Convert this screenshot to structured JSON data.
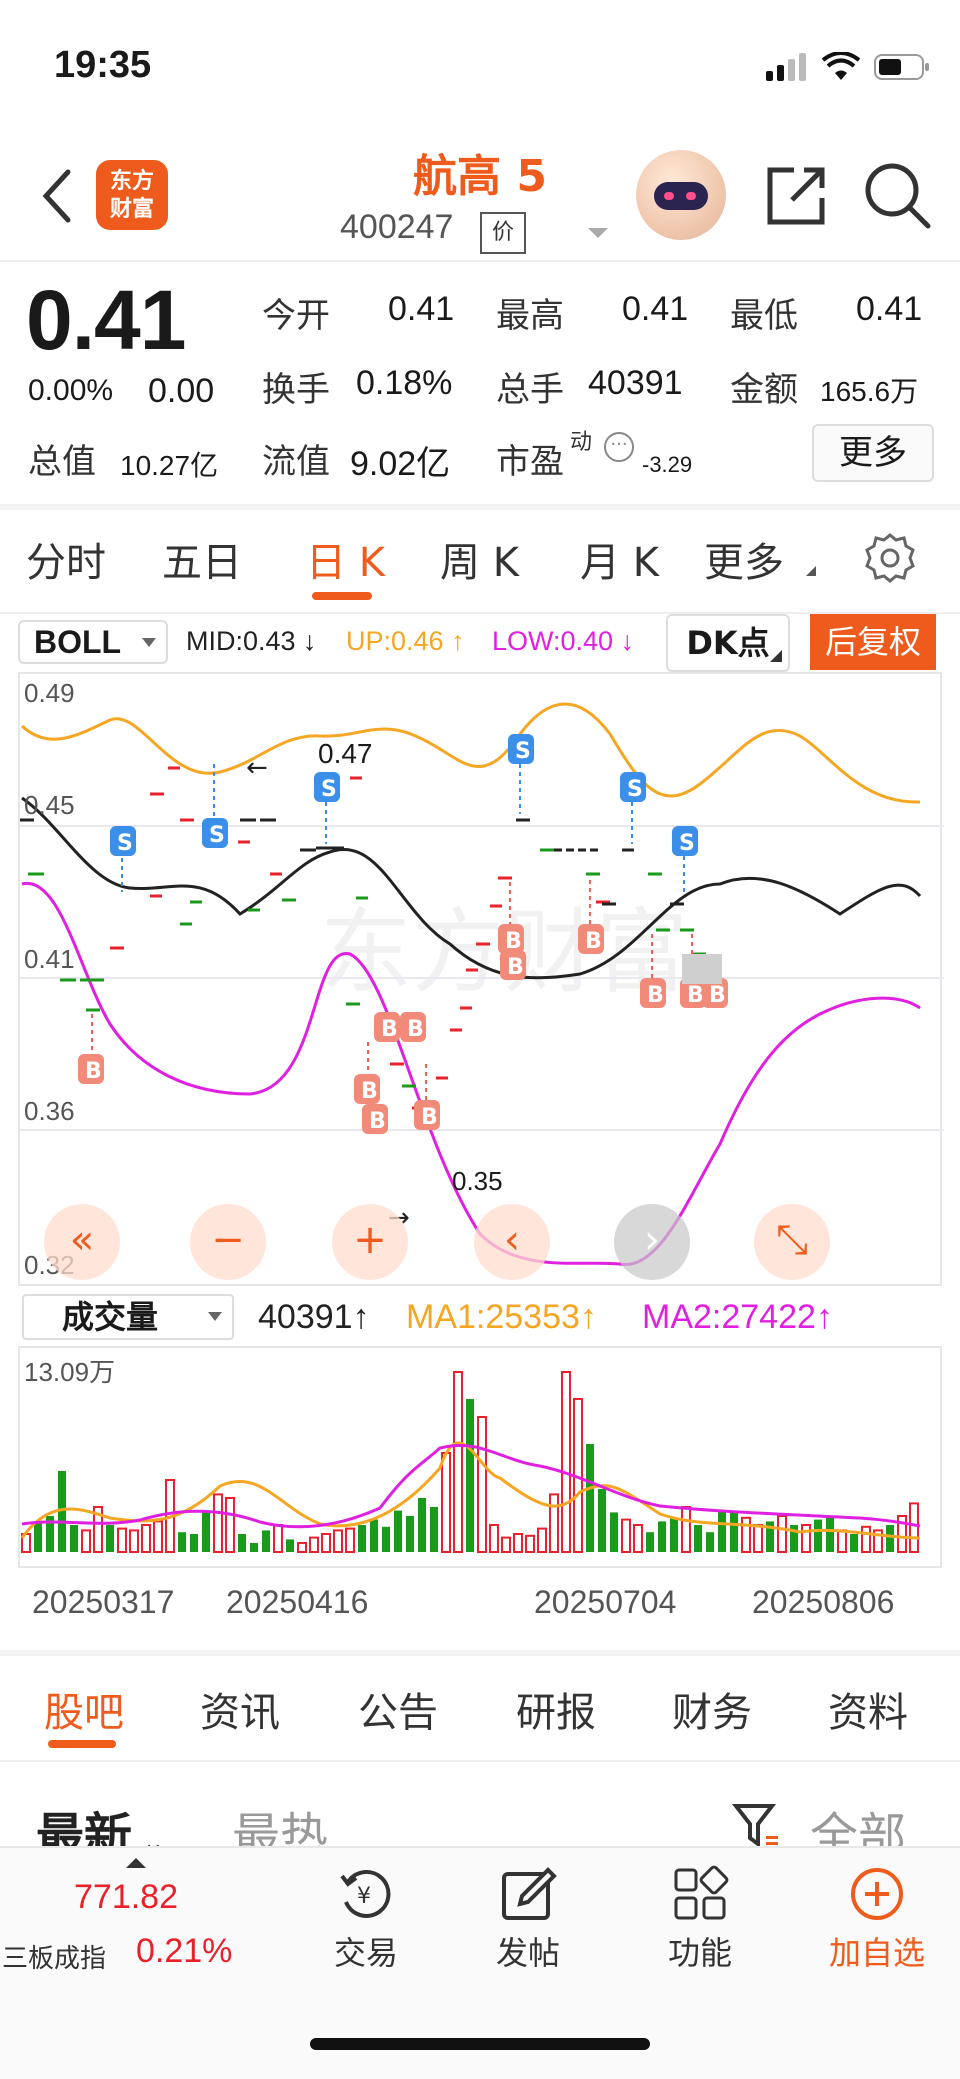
{
  "status_bar": {
    "time": "19:35"
  },
  "header": {
    "logo_line1": "东方",
    "logo_line2": "财富",
    "stock_name": "航高 5",
    "stock_code": "400247",
    "price_tag": "价"
  },
  "quote": {
    "price": "0.41",
    "change_pct": "0.00%",
    "change_amt": "0.00",
    "open_label": "今开",
    "open_value": "0.41",
    "high_label": "最高",
    "high_value": "0.41",
    "low_label": "最低",
    "low_value": "0.41",
    "turnover_label": "换手",
    "turnover_value": "0.18%",
    "volume_label": "总手",
    "volume_value": "40391",
    "amount_label": "金额",
    "amount_value": "165.6万",
    "mktcap_label": "总值",
    "mktcap_value": "10.27亿",
    "float_label": "流值",
    "float_value": "9.02亿",
    "pe_label": "市盈",
    "pe_sup": "动",
    "pe_value": "-3.29",
    "more_label": "更多"
  },
  "ktabs": [
    "分时",
    "五日",
    "日 K",
    "周 K",
    "月 K",
    "更多"
  ],
  "indicator": {
    "select": "BOLL",
    "mid": "MID:0.43",
    "up": "UP:0.46",
    "low": "LOW:0.40",
    "dk_label": "DK点",
    "adjust_label": "后复权"
  },
  "colors": {
    "accent": "#ee5b1c",
    "up": "#e8212b",
    "down": "#1a9a1a",
    "ma1": "#f5a623",
    "ma2": "#e020e0",
    "mid": "#222222"
  },
  "chart": {
    "y_labels": [
      "0.49",
      "0.45",
      "0.41",
      "0.36",
      "0.32"
    ],
    "annot_high": "0.47",
    "annot_low": "0.35"
  },
  "chart_controls": [
    "«",
    "−",
    "+",
    "‹",
    "›",
    "⤡"
  ],
  "volume": {
    "select": "成交量",
    "value": "40391↑",
    "ma1": "MA1:25353↑",
    "ma2": "MA2:27422↑",
    "y_label": "13.09万",
    "dates": [
      "20250317",
      "20250416",
      "20250704",
      "20250806"
    ]
  },
  "bottom_tabs": [
    "股吧",
    "资讯",
    "公告",
    "研报",
    "财务",
    "资料"
  ],
  "feed": {
    "latest": "最新",
    "hot": "最热",
    "filter": "全部"
  },
  "bottom_nav": {
    "index_value": "771.82",
    "index_name": "三板成指",
    "index_pct": "0.21%",
    "trade": "交易",
    "post": "发帖",
    "function": "功能",
    "add_watch": "加自选"
  },
  "icons": [
    "back-icon",
    "share-icon",
    "search-icon",
    "gear-icon",
    "trade-icon",
    "post-icon",
    "function-icon",
    "add-icon",
    "filter-icon"
  ]
}
